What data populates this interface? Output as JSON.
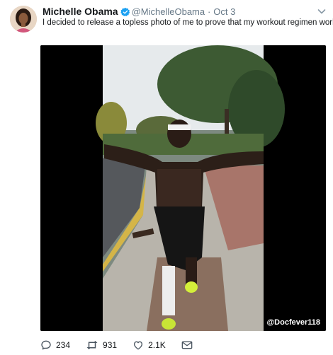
{
  "tweet": {
    "display_name": "Michelle Obama",
    "handle": "@MichelleObama",
    "separator": "·",
    "time": "Oct 3",
    "text": "I decided to release a topless photo of me to prove that my workout regimen works.",
    "media_watermark": "@Docfever118",
    "icons": {
      "verified": "verified-badge-icon",
      "menu": "chevron-down-icon",
      "reply": "reply-icon",
      "retweet": "retweet-icon",
      "like": "heart-icon",
      "message": "envelope-icon"
    },
    "actions": {
      "reply_count": "234",
      "retweet_count": "931",
      "like_count": "2.1K"
    },
    "colors": {
      "verified": "#1da1f2",
      "text": "#14171a",
      "muted": "#657786"
    }
  }
}
